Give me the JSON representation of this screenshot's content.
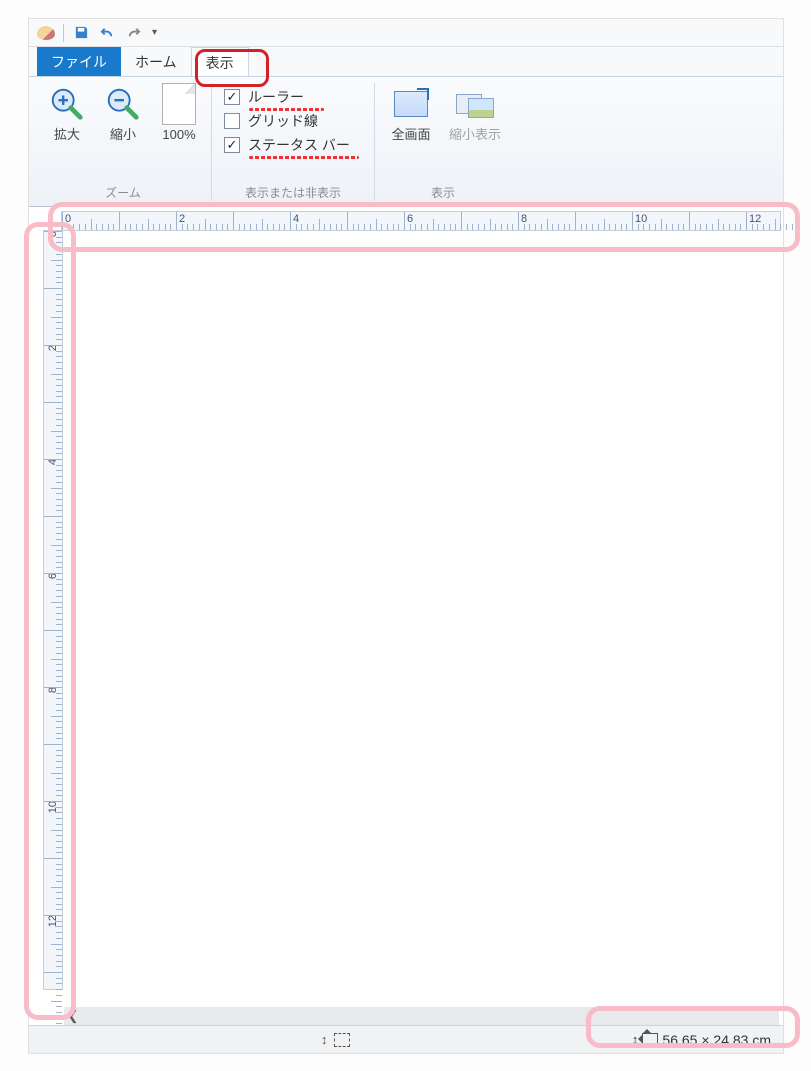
{
  "qat": {
    "app_icon": "paint-palette-icon",
    "save": "save-icon",
    "undo": "undo-icon",
    "redo": "redo-icon",
    "dropdown": "customize-dropdown"
  },
  "tabs": {
    "file": "ファイル",
    "home": "ホーム",
    "view": "表示"
  },
  "ribbon": {
    "zoom_group": {
      "zoom_in": "拡大",
      "zoom_out": "縮小",
      "zoom_100": "100%",
      "label": "ズーム"
    },
    "show_group": {
      "ruler": {
        "label": "ルーラー",
        "checked": true
      },
      "grid": {
        "label": "グリッド線",
        "checked": false
      },
      "statusbar": {
        "label": "ステータス バー",
        "checked": true
      },
      "label": "表示または非表示"
    },
    "display_group": {
      "fullscreen": "全画面",
      "thumbnail": "縮小表示",
      "label": "表示"
    }
  },
  "ruler_h_labels": [
    "0",
    "2",
    "4",
    "6",
    "8",
    "10",
    "12"
  ],
  "ruler_v_labels": [
    "0",
    "2",
    "4",
    "6",
    "8",
    "10",
    "12"
  ],
  "status": {
    "size": "56.65 × 24.83 cm"
  }
}
